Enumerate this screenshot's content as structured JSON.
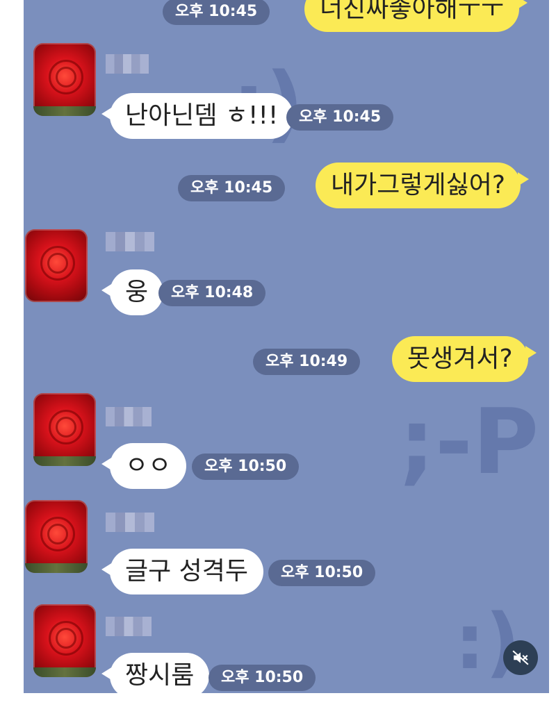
{
  "messages": [
    {
      "side": "right",
      "text": "너진짜좋아해ㅜㅜ",
      "time": "오후 10:45"
    },
    {
      "side": "left",
      "text": "난아닌뎀 ㅎ!!!",
      "time": "오후 10:45"
    },
    {
      "side": "right",
      "text": "내가그렇게싫어?",
      "time": "오후 10:45"
    },
    {
      "side": "left",
      "text": "웅",
      "time": "오후 10:48"
    },
    {
      "side": "right",
      "text": "못생겨서?",
      "time": "오후 10:49"
    },
    {
      "side": "left",
      "text": "ㅇㅇ",
      "time": "오후 10:50"
    },
    {
      "side": "left",
      "text": "글구 성격두",
      "time": "오후 10:50"
    },
    {
      "side": "left",
      "text": "짱시룸",
      "time": "오후 10:50"
    }
  ],
  "icons": {
    "mute": "speaker-muted-icon",
    "avatar": "rose-avatar"
  },
  "colors": {
    "background": "#7b8fbd",
    "my_bubble": "#fbea55",
    "their_bubble": "#ffffff",
    "time_pill": "#5a6a93"
  }
}
